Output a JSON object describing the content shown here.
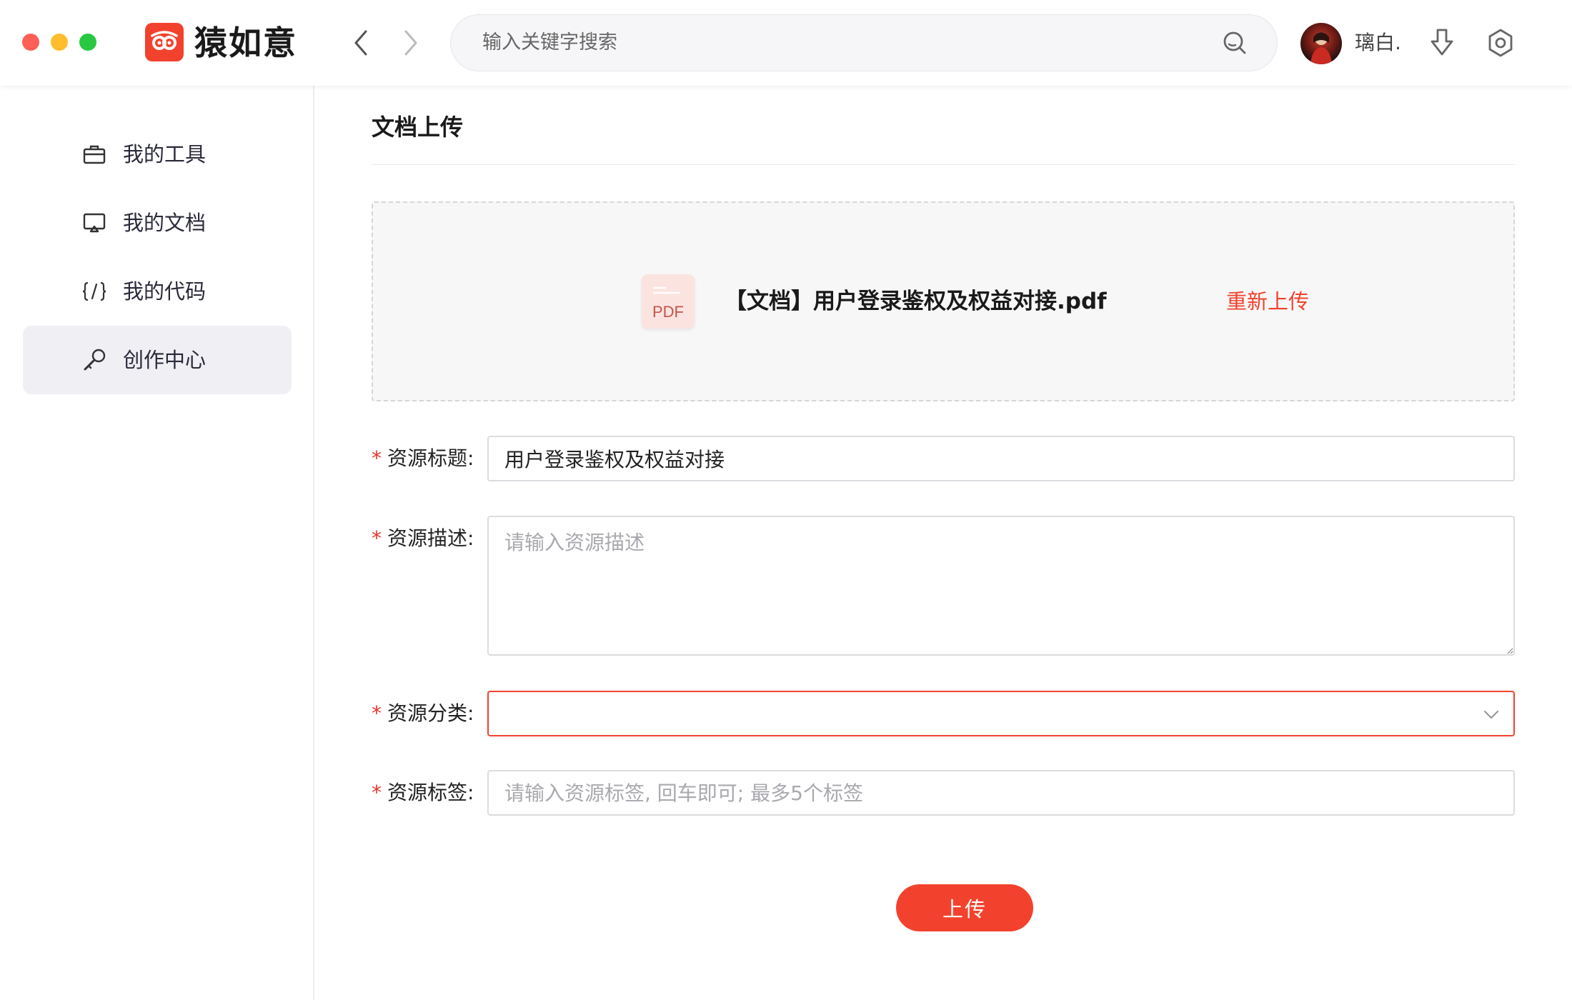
{
  "app": {
    "name": "猿如意",
    "brand_color": "#f2422d"
  },
  "topbar": {
    "search_placeholder": "输入关键字搜索",
    "username": "璃白.",
    "icons": [
      "back-arrow-icon",
      "forward-arrow-icon",
      "search-icon",
      "download-icon",
      "settings-icon"
    ]
  },
  "sidebar": {
    "items": [
      {
        "label": "我的工具",
        "icon": "toolbox-icon",
        "active": false
      },
      {
        "label": "我的文档",
        "icon": "document-screen-icon",
        "active": false
      },
      {
        "label": "我的代码",
        "icon": "code-braces-icon",
        "active": false
      },
      {
        "label": "创作中心",
        "icon": "wrench-icon",
        "active": true
      }
    ]
  },
  "main": {
    "title": "文档上传",
    "upload": {
      "file_type": "PDF",
      "file_name": "【文档】用户登录鉴权及权益对接.pdf",
      "reupload_label": "重新上传"
    },
    "form": {
      "required_mark": "*",
      "title_label": "资源标题:",
      "title_value": "用户登录鉴权及权益对接",
      "desc_label": "资源描述:",
      "desc_placeholder": "请输入资源描述",
      "category_label": "资源分类:",
      "category_value": "",
      "tags_label": "资源标签:",
      "tags_placeholder": "请输入资源标签, 回车即可; 最多5个标签"
    },
    "submit_label": "上传"
  }
}
